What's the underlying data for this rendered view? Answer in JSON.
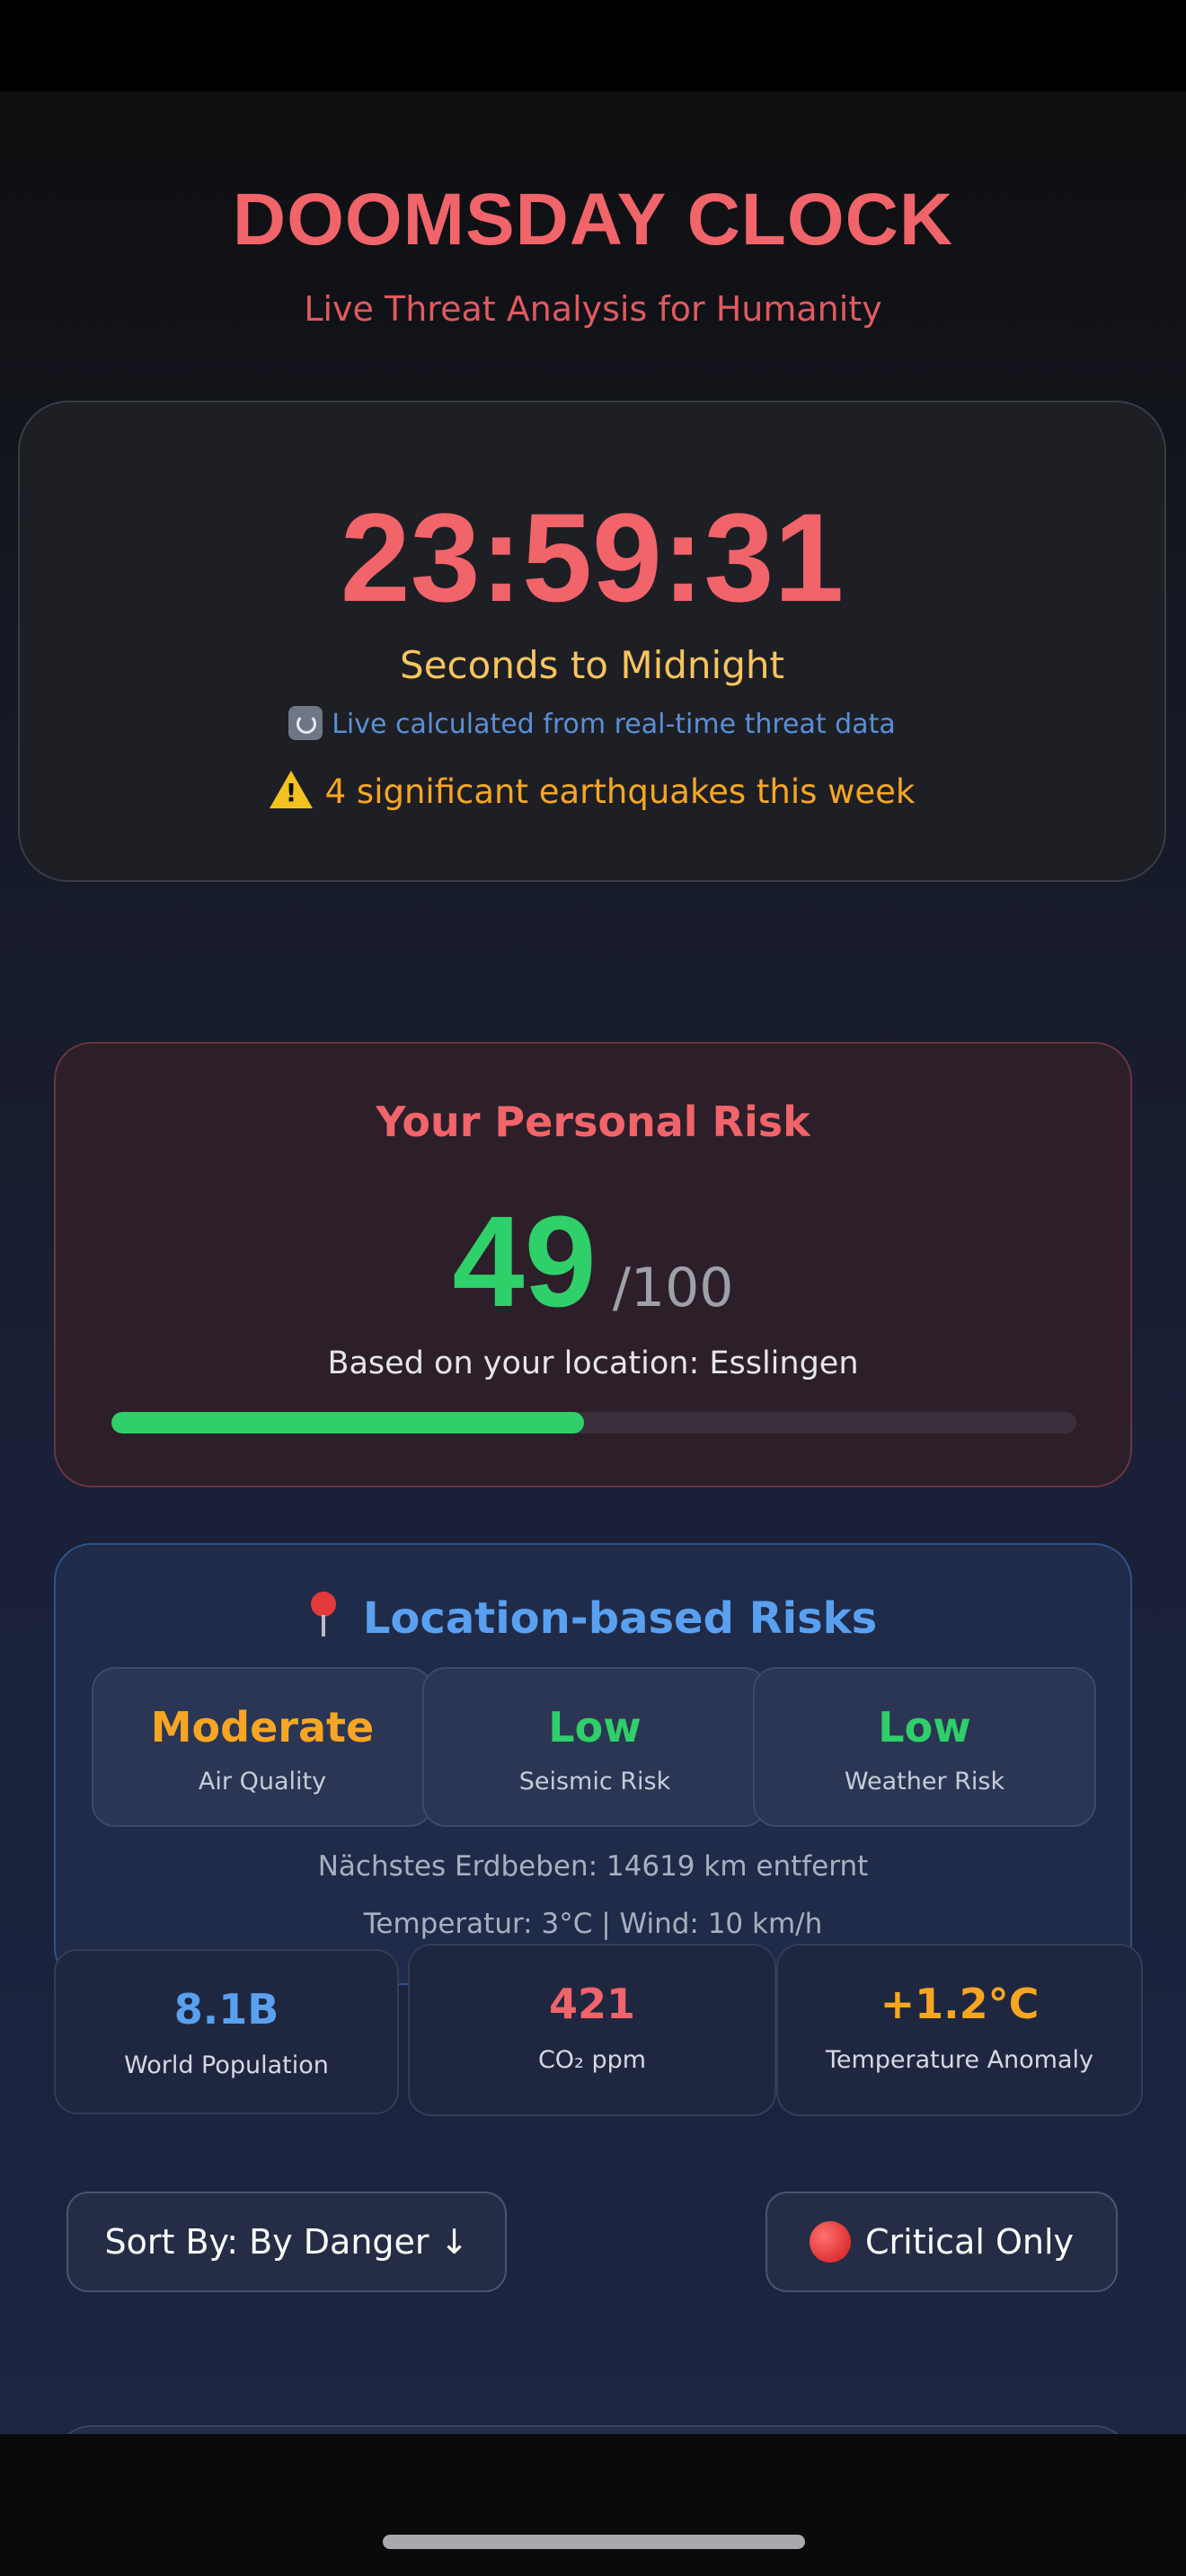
{
  "header": {
    "title": "DOOMSDAY CLOCK",
    "subtitle": "Live Threat Analysis for Humanity"
  },
  "clock": {
    "time": "23:59:31",
    "label": "Seconds to Midnight",
    "live_note": "Live calculated from real-time threat data",
    "live_icon": "refresh-icon",
    "quake_note": "4 significant earthquakes this week",
    "quake_icon": "warning-icon"
  },
  "personal_risk": {
    "title": "Your Personal Risk",
    "score": "49",
    "max": "/100",
    "location_text": "Based on your location: Esslingen",
    "progress_fraction": 0.49,
    "color": "#2fcf6a"
  },
  "location_risks": {
    "title": "Location-based Risks",
    "icon": "pin-icon",
    "metrics": [
      {
        "value": "Moderate",
        "label": "Air Quality",
        "color": "#f6a623"
      },
      {
        "value": "Low",
        "label": "Seismic Risk",
        "color": "#2fcf6a"
      },
      {
        "value": "Low",
        "label": "Weather Risk",
        "color": "#2fcf6a"
      }
    ],
    "nearest_quake": "Nächstes Erdbeben: 14619 km entfernt",
    "weather": "Temperatur: 3°C | Wind: 10 km/h"
  },
  "stats": [
    {
      "value": "8.1B",
      "label": "World Population",
      "color": "#5aa0f0"
    },
    {
      "value": "421",
      "label": "CO₂ ppm",
      "color": "#f0646a"
    },
    {
      "value": "+1.2°C",
      "label": "Temperature Anomaly",
      "color": "#f6a623"
    }
  ],
  "controls": {
    "sort_label": "Sort By: By Danger ↓",
    "critical_label": "Critical Only"
  },
  "threat_card": {
    "icon": "thermometer-icon",
    "expand_icon": "arrow-up-icon"
  }
}
